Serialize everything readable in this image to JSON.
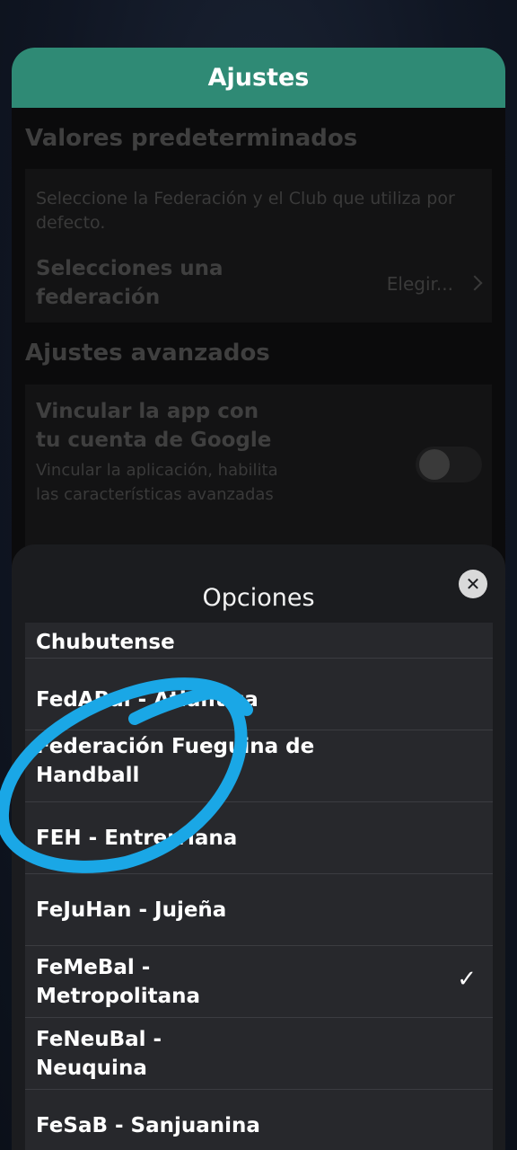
{
  "header": {
    "title": "Ajustes"
  },
  "defaults_section": {
    "title": "Valores predeterminados",
    "description": "Seleccione la Federación y el Club que utiliza por defecto.",
    "federation_label": "Selecciones una federación",
    "federation_value": "Elegir..."
  },
  "advanced_section": {
    "title": "Ajustes avanzados",
    "google_label": "Vincular la app con tu cuenta de Google",
    "google_desc": "Vincular la aplicación, habilita las características avanzadas",
    "google_toggle_on": false
  },
  "sheet": {
    "title": "Opciones",
    "close_icon": "close-icon",
    "options": [
      {
        "label": "Chubutense",
        "selected": false
      },
      {
        "label": "FedABal - Atlántica",
        "selected": false
      },
      {
        "label": "Federación Fueguina de Handball",
        "selected": false
      },
      {
        "label": "FEH - Entrerriana",
        "selected": false
      },
      {
        "label": "FeJuHan - Jujeña",
        "selected": false
      },
      {
        "label": "FeMeBal - Metropolitana",
        "selected": true
      },
      {
        "label": "FeNeuBal - Neuquina",
        "selected": false
      },
      {
        "label": "FeSaB - Sanjuanina",
        "selected": false
      }
    ],
    "check_icon": "✓"
  },
  "colors": {
    "header": "#2f8a75",
    "annotation": "#1aa7e6"
  }
}
